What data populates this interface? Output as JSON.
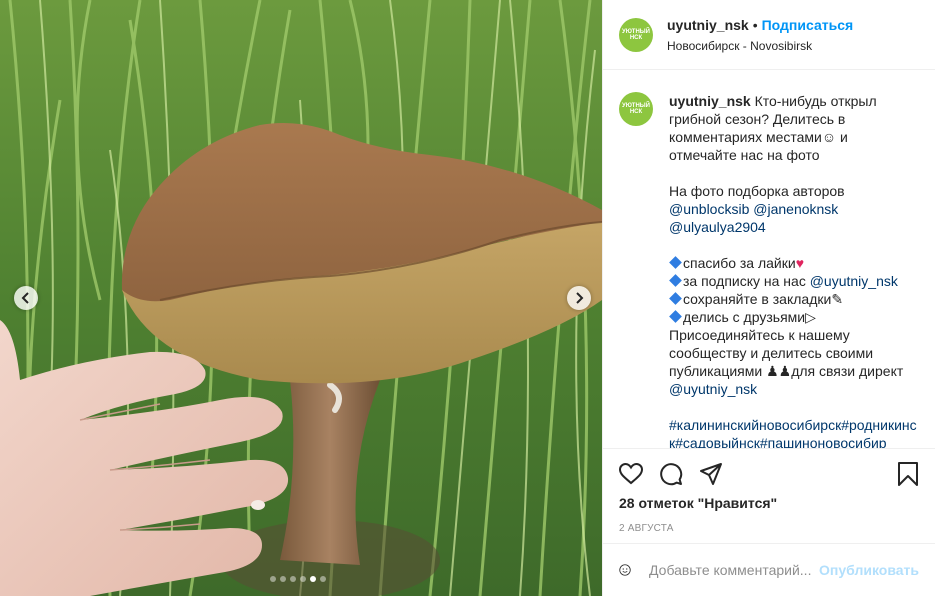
{
  "header": {
    "avatar_text": "УЮТНЫЙ НСК",
    "username": "uyutniy_nsk",
    "bullet": "•",
    "follow_label": "Подписаться",
    "location": "Новосибирск - Novosibirsk"
  },
  "caption": {
    "username": "uyutniy_nsk",
    "line1": "Кто-нибудь открыл грибной сезон? Делитесь в комментариях местами☺ и отмечайте нас на фото",
    "authors_intro": "На фото подборка авторов",
    "author1": "@unblocksib",
    "author2": "@janenoknsk",
    "author3": "@ulyaulya2904",
    "item1": "спасибо за лайки",
    "item2_text": "за подписку на нас",
    "item2_link": "@uyutniy_nsk",
    "item3": "сохраняйте в закладки",
    "item4": "делись с друзьями",
    "join_text": "Присоединяйтесь к нашему сообществу и делитесь своими публикациями",
    "direct_text": "для связи директ",
    "direct_link": "@uyutniy_nsk",
    "hashtags": "#калининскийновосибирск#родникинск#садовыйнск#пашиноновосибир"
  },
  "actions": {
    "likes": "28 отметок \"Нравится\"",
    "date": "2 августа"
  },
  "comment": {
    "placeholder": "Добавьте комментарий...",
    "publish_label": "Опубликовать"
  },
  "carousel": {
    "slide_count": 6,
    "active_index": 4
  },
  "colors": {
    "accent": "#0095f6",
    "publish_disabled": "#b2dffc",
    "avatar_bg": "#8dc63f"
  }
}
